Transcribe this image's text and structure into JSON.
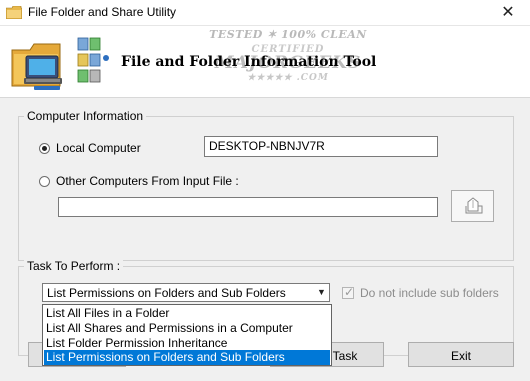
{
  "window": {
    "title": "File Folder and Share Utility",
    "close_symbol": "✕"
  },
  "header": {
    "title": "File and Folder Information Tool",
    "watermark": {
      "line1": "TESTED ✶ 100% CLEAN",
      "line2": "CERTIFIED",
      "line3": "MAJORGEEKS",
      "line4": "★★★★★ .COM"
    }
  },
  "computer_info": {
    "legend": "Computer Information",
    "local_label": "Local Computer",
    "local_value": "DESKTOP-NBNJV7R",
    "other_label": "Other Computers From Input File :",
    "input_file_value": "",
    "local_selected": true
  },
  "task": {
    "legend": "Task To Perform :",
    "selected": "List Permissions on Folders and Sub Folders",
    "subfolder_label": "Do not include sub folders",
    "subfolder_checked": true,
    "options": [
      "List All Files in a Folder",
      "List All Shares and Permissions in a Computer",
      "List Folder Permission Inheritance",
      "List Permissions on Folders and Sub Folders"
    ],
    "selected_index": 3
  },
  "buttons": {
    "run_partial": "Task",
    "exit": "Exit"
  },
  "icons": {
    "title": "folder-icon",
    "logo": "folder-computer-icon",
    "mini": "file-icons",
    "browse": "browse-icon",
    "close": "close-icon",
    "dropdown": "chevron-down-icon"
  },
  "colors": {
    "selection": "#0078d7",
    "group_border": "#d0d0d0",
    "client_bg": "#f0f0f0"
  }
}
